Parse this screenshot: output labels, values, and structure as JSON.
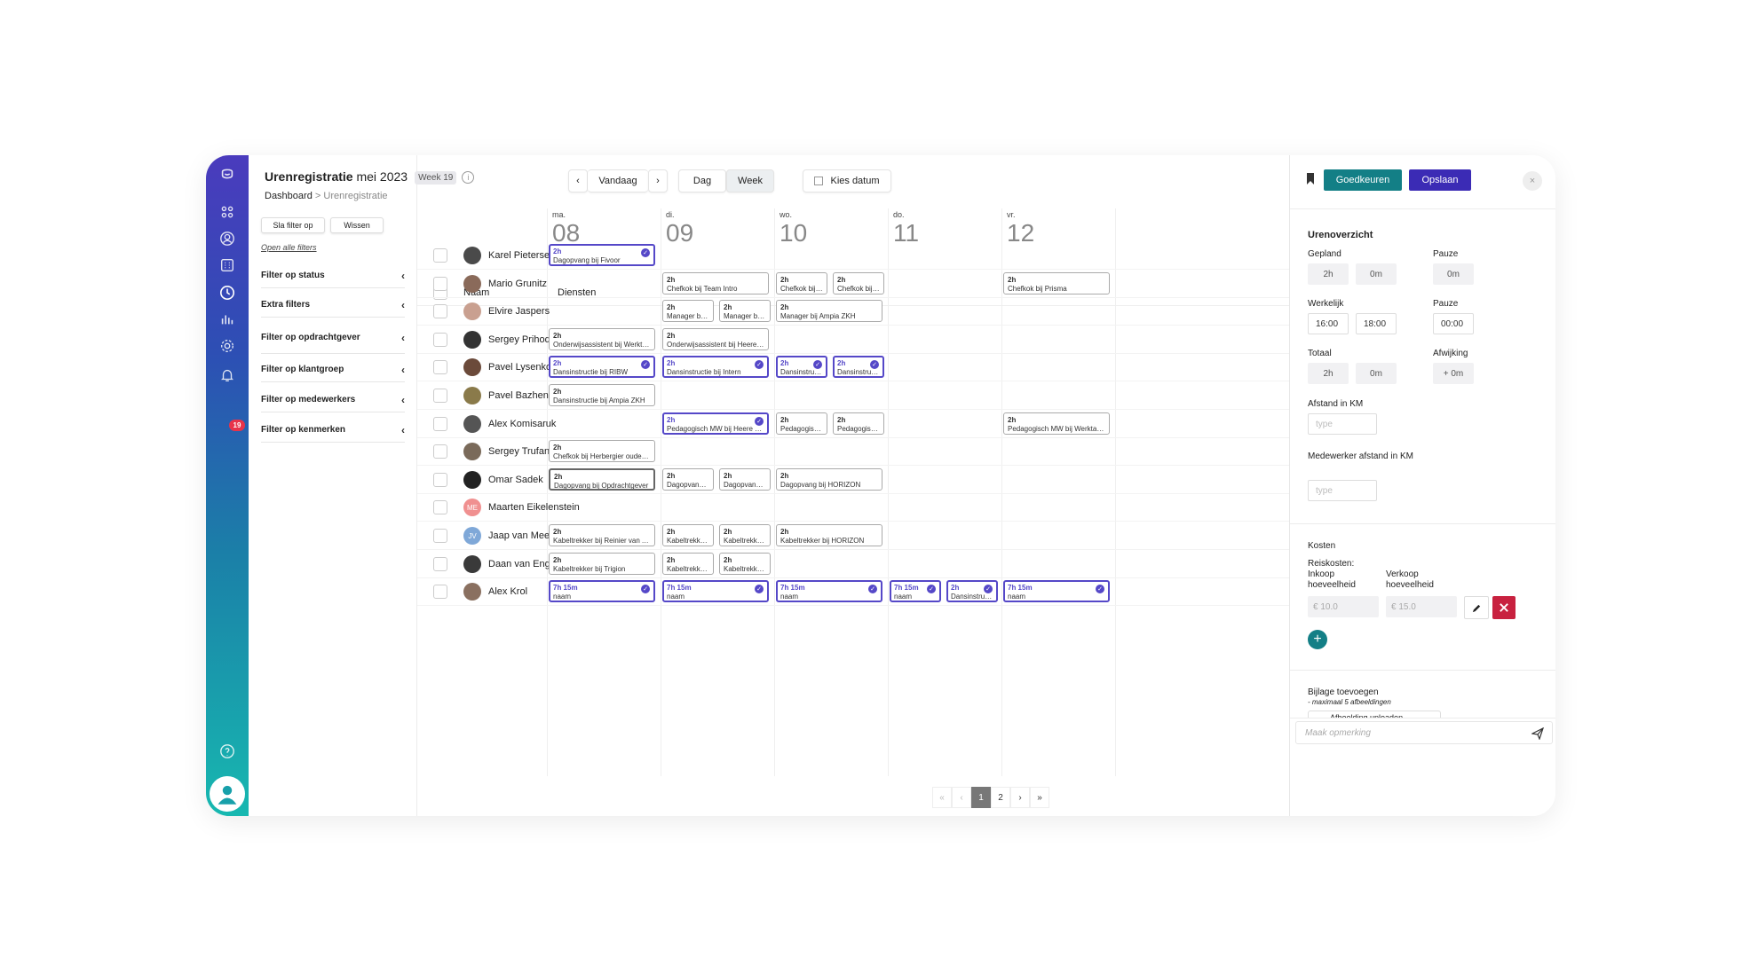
{
  "app": {
    "title_bold": "Urenregistratie",
    "title_rest": " mei 2023",
    "week": "Week 19",
    "info": "i",
    "breadcrumb": [
      "Dashboard",
      ">",
      "Urenregistratie"
    ]
  },
  "rail": {
    "icons": [
      "brand-logo-icon",
      "apps-grid-icon",
      "user-circle-icon",
      "calendar-icon",
      "clock-icon",
      "bar-chart-icon",
      "settings-icon",
      "bell-icon",
      "help-icon",
      "profile-icon"
    ],
    "notifications": "19",
    "help": "?"
  },
  "filters": {
    "save_filter": "Sla filter op",
    "clear": "Wissen",
    "open_all": "Open alle filters",
    "groups": [
      "Filter op status",
      "Extra filters",
      "Filter op opdrachtgever",
      "Filter op klantgroep",
      "Filter op medewerkers",
      "Filter op kenmerken"
    ],
    "chevron": "‹"
  },
  "toolbar": {
    "prev": "‹",
    "today": "Vandaag",
    "next": "›",
    "day": "Dag",
    "week": "Week",
    "pick_date": "Kies datum"
  },
  "days": [
    {
      "name": "ma.",
      "date": "08"
    },
    {
      "name": "di.",
      "date": "09"
    },
    {
      "name": "wo.",
      "date": "10"
    },
    {
      "name": "do.",
      "date": "11"
    },
    {
      "name": "vr.",
      "date": "12"
    }
  ],
  "table": {
    "col_name": "Naam",
    "col_services": "Diensten"
  },
  "rows": [
    {
      "name": "Karel Pietersen",
      "initials": "",
      "color": "#4a4a4a",
      "shifts": [
        {
          "day": 0,
          "half": 0,
          "span": 2,
          "h": "2h",
          "t": "Dagopvang bij Fivoor",
          "ap": true
        }
      ]
    },
    {
      "name": "Mario Grunitz",
      "initials": "",
      "color": "#8a6a5a",
      "shifts": [
        {
          "day": 1,
          "half": 0,
          "span": 2,
          "h": "2h",
          "t": "Chefkok bij Team Intro"
        },
        {
          "day": 2,
          "half": 0,
          "span": 1,
          "h": "2h",
          "t": "Chefkok bij R..."
        },
        {
          "day": 2,
          "half": 1,
          "span": 1,
          "h": "2h",
          "t": "Chefkok bij ..."
        },
        {
          "day": 4,
          "half": 0,
          "span": 2,
          "h": "2h",
          "t": "Chefkok bij Prisma"
        }
      ]
    },
    {
      "name": "Elvire Jaspers",
      "initials": "",
      "color": "#c9a090",
      "shifts": [
        {
          "day": 1,
          "half": 0,
          "span": 1,
          "h": "2h",
          "t": "Manager bij ..."
        },
        {
          "day": 1,
          "half": 1,
          "span": 1,
          "h": "2h",
          "t": "Manager bij ..."
        },
        {
          "day": 2,
          "half": 0,
          "span": 2,
          "h": "2h",
          "t": "Manager bij Ampia ZKH"
        }
      ]
    },
    {
      "name": "Sergey Prihodko",
      "initials": "",
      "color": "#333",
      "shifts": [
        {
          "day": 0,
          "half": 0,
          "span": 2,
          "h": "2h",
          "t": "Onderwijsassistent bij Werktalent"
        },
        {
          "day": 1,
          "half": 0,
          "span": 2,
          "h": "2h",
          "t": "Onderwijsassistent bij Heere aa..."
        }
      ]
    },
    {
      "name": "Pavel Lysenko",
      "initials": "",
      "color": "#6b4a3a",
      "shifts": [
        {
          "day": 0,
          "half": 0,
          "span": 2,
          "h": "2h",
          "t": "Dansinstructie bij RIBW",
          "ap": true
        },
        {
          "day": 1,
          "half": 0,
          "span": 2,
          "h": "2h",
          "t": "Dansinstructie bij Intern",
          "ap": true
        },
        {
          "day": 2,
          "half": 0,
          "span": 1,
          "h": "2h",
          "t": "Dansinstructi...",
          "ap": true
        },
        {
          "day": 2,
          "half": 1,
          "span": 1,
          "h": "2h",
          "t": "Dansinstructi...",
          "ap": true
        }
      ]
    },
    {
      "name": "Pavel Bazhenov",
      "initials": "",
      "color": "#8a7a4a",
      "shifts": [
        {
          "day": 0,
          "half": 0,
          "span": 2,
          "h": "2h",
          "t": "Dansinstructie bij Ampia ZKH"
        }
      ]
    },
    {
      "name": "Alex Komisaruk",
      "initials": "",
      "color": "#555",
      "shifts": [
        {
          "day": 1,
          "half": 0,
          "span": 2,
          "h": "2h",
          "t": "Pedagogisch MW bij Heere aan ...",
          "ap": true
        },
        {
          "day": 2,
          "half": 0,
          "span": 1,
          "h": "2h",
          "t": "Pedagogisch ..."
        },
        {
          "day": 2,
          "half": 1,
          "span": 1,
          "h": "2h",
          "t": "Pedagogisch ..."
        },
        {
          "day": 4,
          "half": 0,
          "span": 2,
          "h": "2h",
          "t": "Pedagogisch MW bij Werktalent"
        }
      ]
    },
    {
      "name": "Sergey Trufanov",
      "initials": "",
      "color": "#7a6a5a",
      "shifts": [
        {
          "day": 0,
          "half": 0,
          "span": 2,
          "h": "2h",
          "t": "Chefkok bij Herbergier ouderen..."
        }
      ]
    },
    {
      "name": "Omar Sadek",
      "initials": "",
      "color": "#222",
      "shifts": [
        {
          "day": 0,
          "half": 0,
          "span": 2,
          "h": "2h",
          "t": "Dagopvang bij Opdrachtgever",
          "dark": true
        },
        {
          "day": 1,
          "half": 0,
          "span": 1,
          "h": "2h",
          "t": "Dagopvang b..."
        },
        {
          "day": 1,
          "half": 1,
          "span": 1,
          "h": "2h",
          "t": "Dagopvang b..."
        },
        {
          "day": 2,
          "half": 0,
          "span": 2,
          "h": "2h",
          "t": "Dagopvang bij HORIZON"
        }
      ]
    },
    {
      "name": "Maarten Eikelenstein",
      "initials": "ME",
      "color": "#f09090",
      "shifts": []
    },
    {
      "name": "Jaap van Meerveld",
      "initials": "JV",
      "color": "#7fa8d8",
      "shifts": [
        {
          "day": 0,
          "half": 0,
          "span": 2,
          "h": "2h",
          "t": "Kabeltrekker bij Reinier van Arkel"
        },
        {
          "day": 1,
          "half": 0,
          "span": 1,
          "h": "2h",
          "t": "Kabeltrekker ..."
        },
        {
          "day": 1,
          "half": 1,
          "span": 1,
          "h": "2h",
          "t": "Kabeltrekker ..."
        },
        {
          "day": 2,
          "half": 0,
          "span": 2,
          "h": "2h",
          "t": "Kabeltrekker bij HORIZON"
        }
      ]
    },
    {
      "name": "Daan van Engers",
      "initials": "",
      "color": "#3a3a3a",
      "shifts": [
        {
          "day": 0,
          "half": 0,
          "span": 2,
          "h": "2h",
          "t": "Kabeltrekker bij Trigion"
        },
        {
          "day": 1,
          "half": 0,
          "span": 1,
          "h": "2h",
          "t": "Kabeltrekker..."
        },
        {
          "day": 1,
          "half": 1,
          "span": 1,
          "h": "2h",
          "t": "Kabeltrekker ..."
        }
      ]
    },
    {
      "name": "Alex Krol",
      "initials": "",
      "color": "#8a7060",
      "shifts": [
        {
          "day": 0,
          "half": 0,
          "span": 2,
          "h": "7h 15m",
          "t": "naam",
          "ap": true
        },
        {
          "day": 1,
          "half": 0,
          "span": 2,
          "h": "7h 15m",
          "t": "naam",
          "ap": true
        },
        {
          "day": 2,
          "half": 0,
          "span": 2,
          "h": "7h 15m",
          "t": "naam",
          "ap": true
        },
        {
          "day": 3,
          "half": 0,
          "span": 1,
          "h": "7h 15m",
          "t": "naam",
          "ap": true
        },
        {
          "day": 3,
          "half": 1,
          "span": 1,
          "h": "2h",
          "t": "Dansinstructi...",
          "ap": true
        },
        {
          "day": 4,
          "half": 0,
          "span": 2,
          "h": "7h 15m",
          "t": "naam",
          "ap": true
        }
      ]
    }
  ],
  "pager": {
    "first": "«",
    "prev": "‹",
    "pages": [
      "1",
      "2"
    ],
    "next": "›",
    "last": "»"
  },
  "side": {
    "approve": "Goedkeuren",
    "save": "Opslaan",
    "close": "×",
    "overview": "Urenoverzicht",
    "planned": "Gepland",
    "pause": "Pauze",
    "actual": "Werkelijk",
    "total": "Totaal",
    "deviation": "Afwijking",
    "planned_h": "2h",
    "planned_m": "0m",
    "planned_pause": "0m",
    "start": "16:00",
    "end": "18:00",
    "actual_pause": "00:00",
    "total_h": "2h",
    "total_m": "0m",
    "deviation_v": "+ 0m",
    "distance": "Afstand in KM",
    "distance_ph": "type",
    "emp_distance": "Medewerker afstand in KM",
    "emp_distance_ph": "type",
    "costs": "Kosten",
    "travel": "Reiskosten:",
    "buy": "Inkoop hoeveelheid",
    "sell": "Verkoop hoeveelheid",
    "buy_v": "€ 10.0",
    "sell_v": "€ 15.0",
    "attach": "Bijlage toevoegen",
    "attach_note": "- maximaal 5 afbeeldingen",
    "upload": "Afbeelding uploaden",
    "remark_ph": "Maak opmerking"
  }
}
